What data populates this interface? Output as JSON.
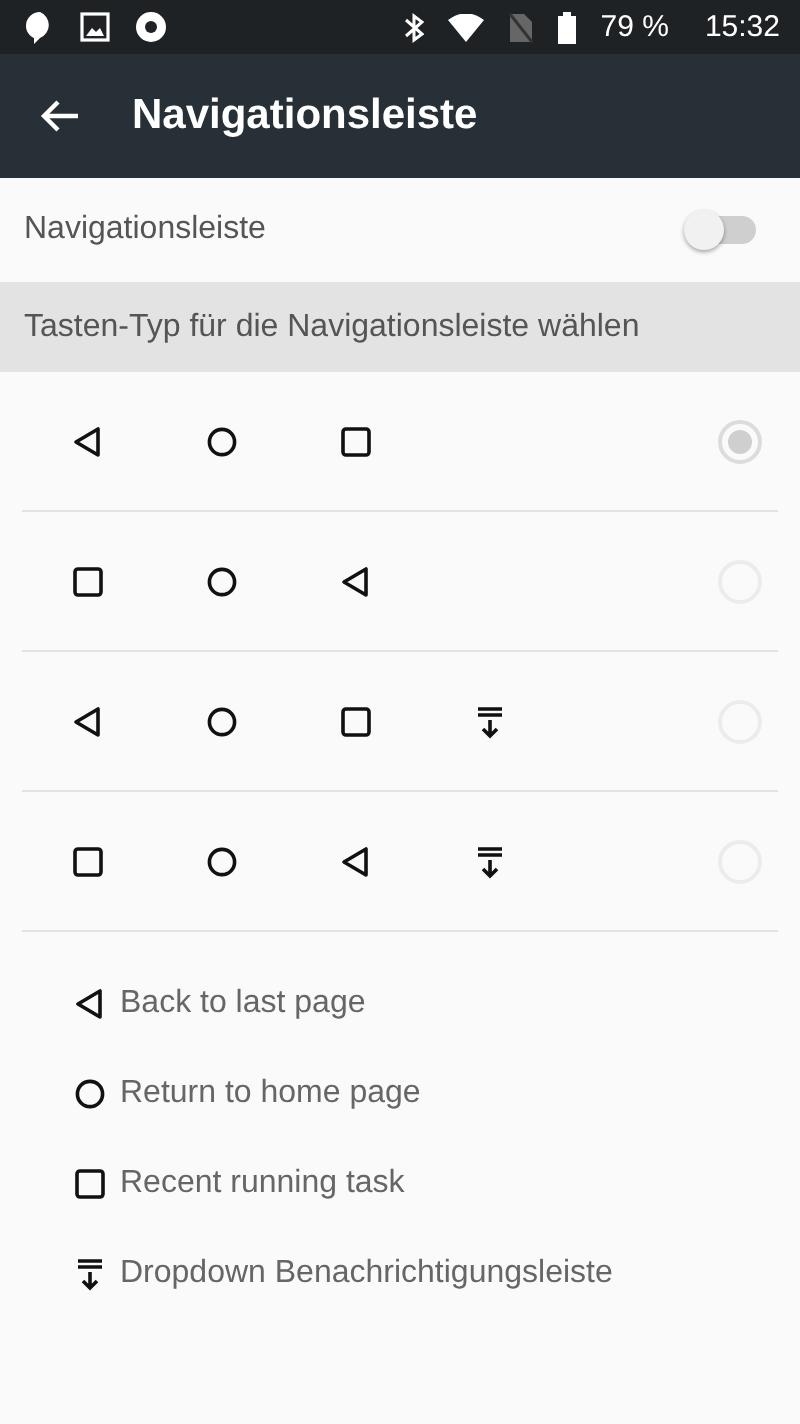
{
  "status_bar": {
    "battery": "79 %",
    "time": "15:32"
  },
  "app_bar": {
    "title": "Navigationsleiste"
  },
  "toggle": {
    "label": "Navigationsleiste",
    "on": false
  },
  "section": {
    "title": "Tasten-Typ für die Navigationsleiste wählen"
  },
  "layouts": [
    {
      "buttons": [
        {
          "kind": "back"
        },
        {
          "kind": "home"
        },
        {
          "kind": "recent"
        }
      ],
      "selected": true
    },
    {
      "buttons": [
        {
          "kind": "recent"
        },
        {
          "kind": "home"
        },
        {
          "kind": "back"
        }
      ],
      "selected": false
    },
    {
      "buttons": [
        {
          "kind": "back"
        },
        {
          "kind": "home"
        },
        {
          "kind": "recent"
        },
        {
          "kind": "notification"
        }
      ],
      "selected": false
    },
    {
      "buttons": [
        {
          "kind": "recent"
        },
        {
          "kind": "home"
        },
        {
          "kind": "back"
        },
        {
          "kind": "notification"
        }
      ],
      "selected": false
    }
  ],
  "legend": [
    {
      "kind": "back",
      "label": "Back to last page"
    },
    {
      "kind": "home",
      "label": "Return to home page"
    },
    {
      "kind": "recent",
      "label": "Recent running task"
    },
    {
      "kind": "notification",
      "label": "Dropdown Benachrichtigungsleiste"
    }
  ]
}
